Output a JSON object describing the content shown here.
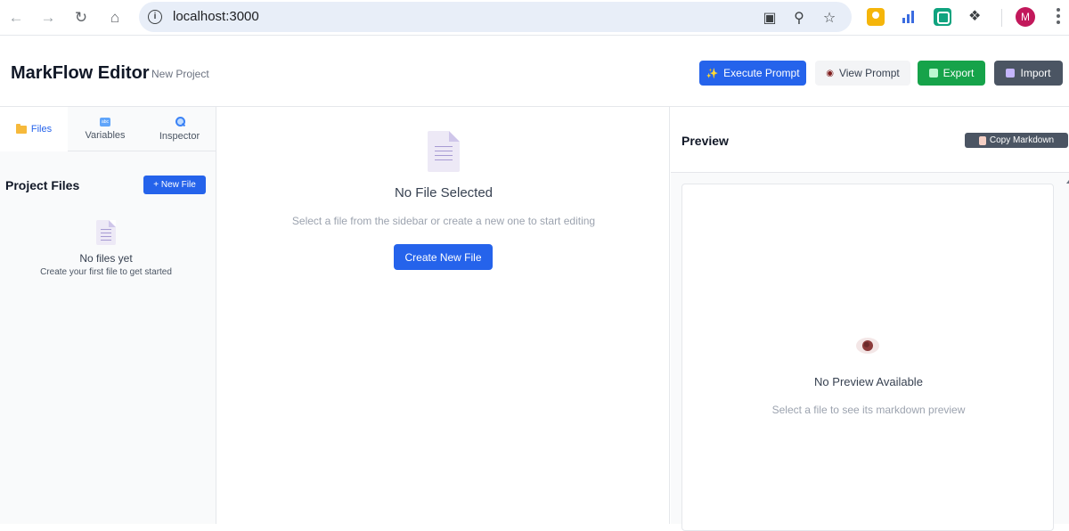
{
  "browser": {
    "url": "localhost:3000",
    "profile_initial": "M",
    "icons": [
      "back-arrow-icon",
      "forward-arrow-icon",
      "reload-icon",
      "home-icon",
      "site-info-icon",
      "install-app-icon",
      "zoom-icon",
      "bookmark-star-icon",
      "extensions-puzzle-icon",
      "more-menu-icon"
    ]
  },
  "header": {
    "title": "MarkFlow Editor",
    "project": "New Project",
    "buttons": {
      "execute": "Execute Prompt",
      "view": "View Prompt",
      "export": "Export",
      "import": "Import"
    }
  },
  "sidebar": {
    "tabs": [
      {
        "label": "Files",
        "icon": "folder-icon",
        "active": true
      },
      {
        "label": "Variables",
        "icon": "abc-icon",
        "active": false
      },
      {
        "label": "Inspector",
        "icon": "magnifier-icon",
        "active": false
      }
    ],
    "title": "Project Files",
    "new_file": "+ New File",
    "empty_title": "No files yet",
    "empty_sub": "Create your first file to get started"
  },
  "editor": {
    "empty_title": "No File Selected",
    "empty_sub": "Select a file from the sidebar or create a new one to start editing",
    "create_button": "Create New File"
  },
  "preview": {
    "title": "Preview",
    "copy_button": "Copy Markdown",
    "empty_title": "No Preview Available",
    "empty_sub": "Select a file to see its markdown preview"
  },
  "colors": {
    "primary": "#2563eb",
    "export": "#16a34a",
    "dark_button": "#4b5563",
    "profile": "#c2185b"
  }
}
